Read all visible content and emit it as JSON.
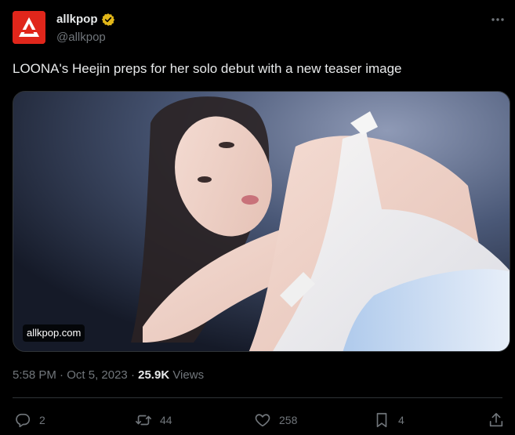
{
  "author": {
    "display_name": "allkpop",
    "handle": "@allkpop",
    "verified": true,
    "avatar_color": "#e0261b",
    "verified_color": "#e2b719"
  },
  "tweet": {
    "text": "LOONA's Heejin preps for her solo debut with a new teaser image",
    "media_source": "allkpop.com"
  },
  "meta": {
    "time": "5:58 PM",
    "separator": "·",
    "date": "Oct 5, 2023",
    "views_count": "25.9K",
    "views_label": "Views"
  },
  "actions": {
    "replies": "2",
    "reposts": "44",
    "likes": "258",
    "bookmarks": "4"
  },
  "icons": [
    "more-icon",
    "reply-icon",
    "repost-icon",
    "like-icon",
    "bookmark-icon",
    "share-icon",
    "verified-badge-icon"
  ],
  "colors": {
    "background": "#000000",
    "text_primary": "#e7e9ea",
    "text_secondary": "#71767b",
    "border": "#2f3336"
  }
}
